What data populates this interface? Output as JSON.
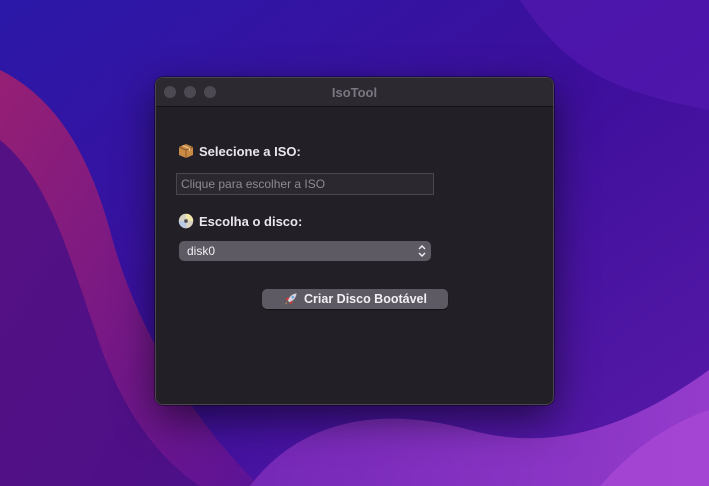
{
  "window": {
    "title": "IsoTool"
  },
  "iso_section": {
    "label": "Selecione a ISO:",
    "icon": "package-icon",
    "input_placeholder": "Clique para escolher a ISO"
  },
  "disk_section": {
    "label": "Escolha o disco:",
    "icon": "dvd-icon",
    "selected": "disk0"
  },
  "action": {
    "label": "Criar Disco Bootável",
    "icon": "rocket-icon"
  }
}
